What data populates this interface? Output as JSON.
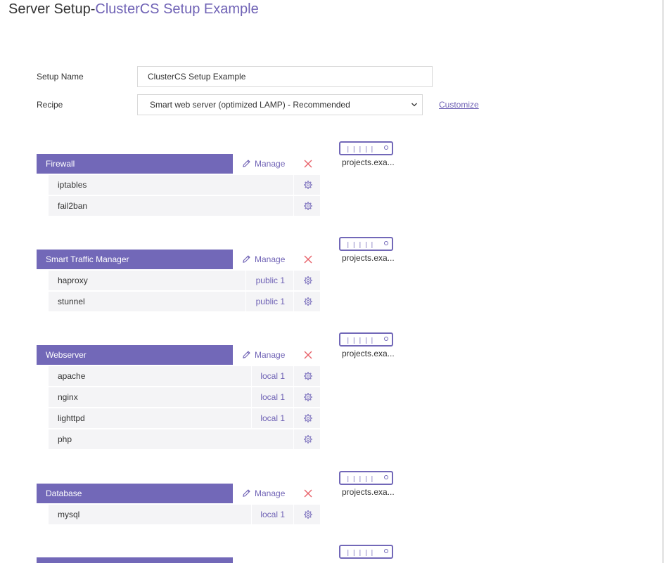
{
  "page": {
    "title_prefix": "Server Setup-",
    "title_accent": "ClusterCS Setup Example"
  },
  "form": {
    "setup_name_label": "Setup Name",
    "setup_name_value": "ClusterCS Setup Example",
    "recipe_label": "Recipe",
    "recipe_selected": "Smart web server (optimized LAMP) - Recommended",
    "customize_link": "Customize"
  },
  "common": {
    "manage_label": "Manage"
  },
  "groups": [
    {
      "name": "Firewall",
      "server_name": "projects.exa...",
      "items": [
        {
          "name": "iptables",
          "tag": ""
        },
        {
          "name": "fail2ban",
          "tag": ""
        }
      ]
    },
    {
      "name": "Smart Traffic Manager",
      "server_name": "projects.exa...",
      "items": [
        {
          "name": "haproxy",
          "tag": "public 1"
        },
        {
          "name": "stunnel",
          "tag": "public 1"
        }
      ]
    },
    {
      "name": "Webserver",
      "server_name": "projects.exa...",
      "items": [
        {
          "name": "apache",
          "tag": "local 1"
        },
        {
          "name": "nginx",
          "tag": "local 1"
        },
        {
          "name": "lighttpd",
          "tag": "local 1"
        },
        {
          "name": "php",
          "tag": ""
        }
      ]
    },
    {
      "name": "Database",
      "server_name": "projects.exa...",
      "items": [
        {
          "name": "mysql",
          "tag": "local 1"
        }
      ]
    },
    {
      "name": "",
      "server_name": "",
      "items": []
    }
  ],
  "colors": {
    "accent": "#7268b8",
    "link": "#6f62b5",
    "remove": "#e8636b",
    "row_bg": "#f4f4f6"
  },
  "icons": {
    "manage": "pencil-icon",
    "remove": "close-icon",
    "settings": "gear-icon",
    "server": "server-icon",
    "select": "chevron-down-icon"
  }
}
